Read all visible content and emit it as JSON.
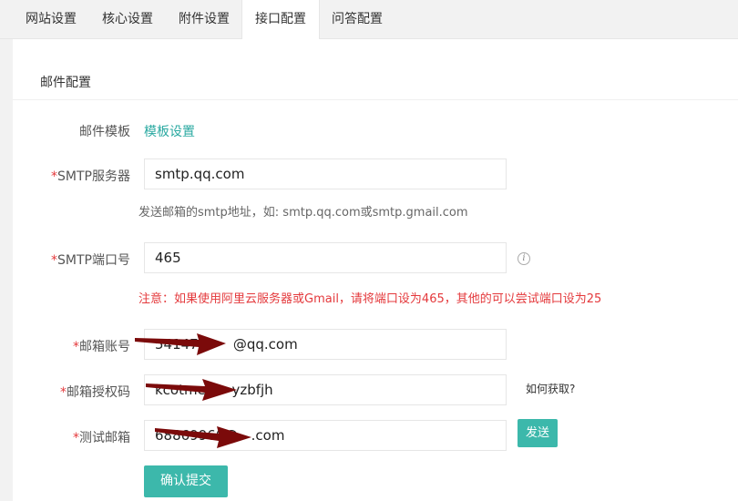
{
  "tabs": [
    {
      "label": "网站设置"
    },
    {
      "label": "核心设置"
    },
    {
      "label": "附件设置"
    },
    {
      "label": "接口配置"
    },
    {
      "label": "问答配置"
    }
  ],
  "active_tab": "接口配置",
  "section_title": "邮件配置",
  "form": {
    "template": {
      "label": "邮件模板",
      "link": "模板设置"
    },
    "smtp_server": {
      "required": "*",
      "label": "SMTP服务器",
      "value": "smtp.qq.com",
      "help": "发送邮箱的smtp地址，如: smtp.qq.com或smtp.gmail.com"
    },
    "smtp_port": {
      "required": "*",
      "label": "SMTP端口号",
      "value": "465",
      "warning": "注意：如果使用阿里云服务器或Gmail，请将端口设为465，其他的可以尝试端口设为25"
    },
    "account": {
      "required": "*",
      "label": "邮箱账号",
      "value": "541475      @qq.com"
    },
    "auth_code": {
      "required": "*",
      "label": "邮箱授权码",
      "value": "kcotme      yzbfjh",
      "help_link": "如何获取?"
    },
    "test_email": {
      "required": "*",
      "label": "测试邮箱",
      "value": "68869960@   .com",
      "send_button": "发送"
    }
  },
  "submit_button": "确认提交",
  "colors": {
    "accent": "#3cb8ab",
    "link": "#2aa9a1",
    "required": "#e4393c",
    "arrow": "#7b0a0a"
  }
}
